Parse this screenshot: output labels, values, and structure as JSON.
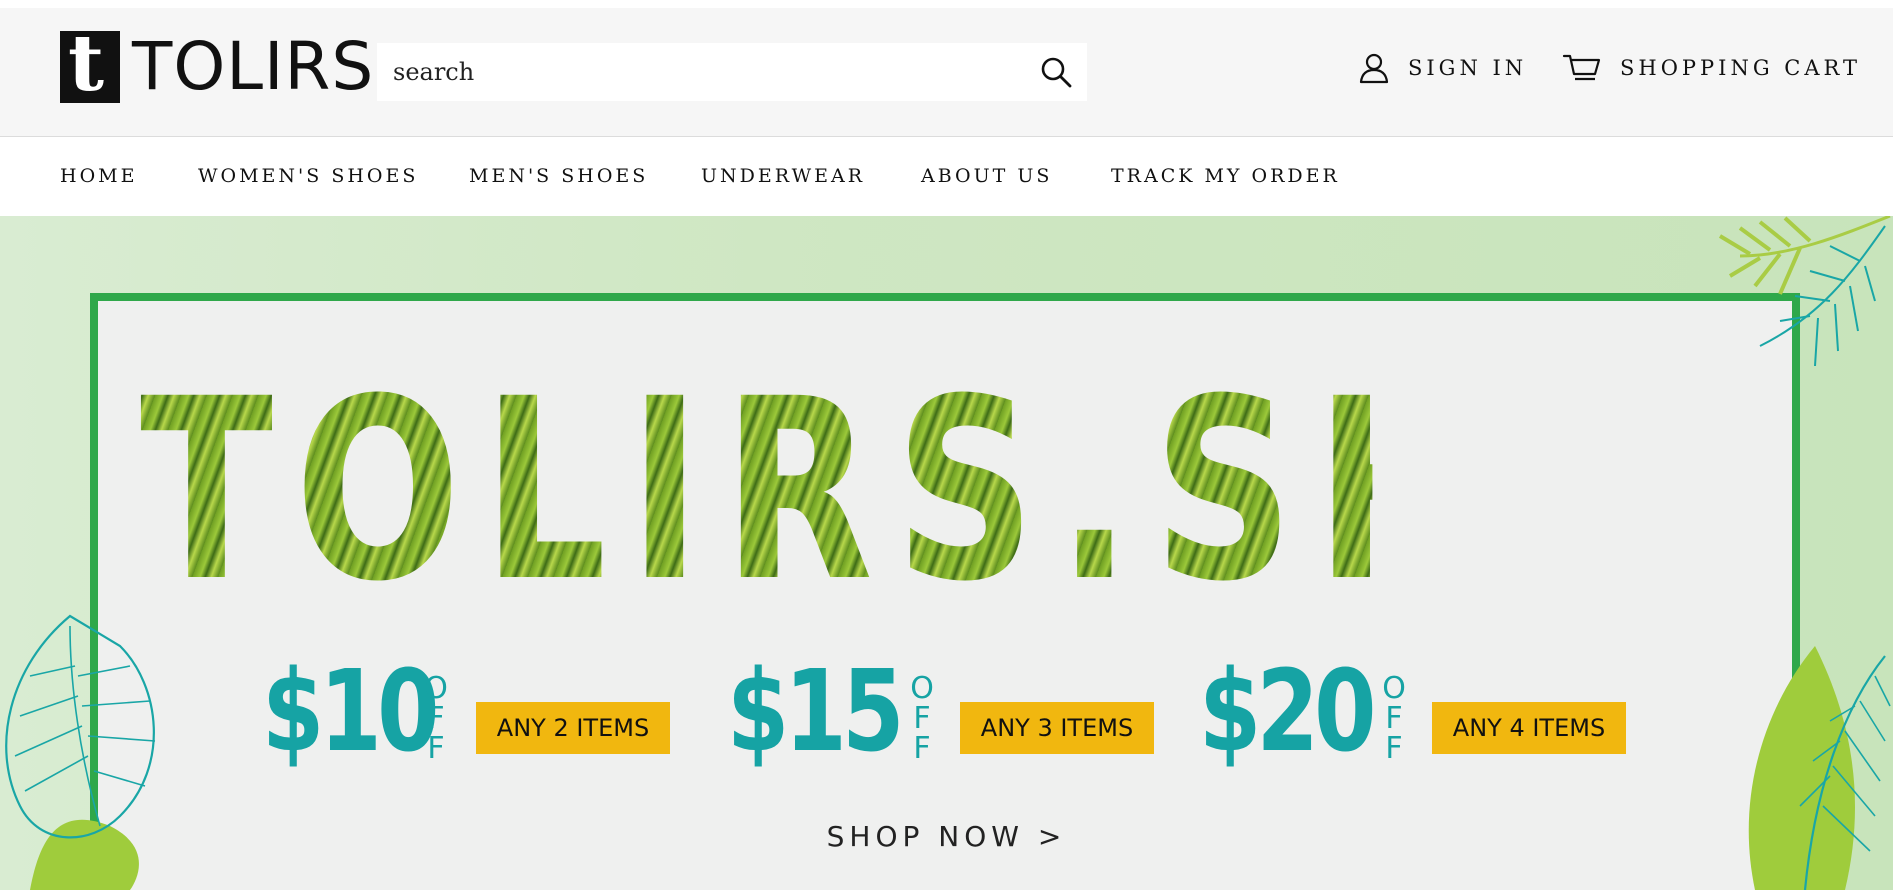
{
  "header": {
    "logo_mark": "t",
    "logo_text": "TOLIRS",
    "search_placeholder": "search",
    "sign_in": "SIGN IN",
    "cart": "SHOPPING CART",
    "search_icon": "search-icon",
    "account_icon": "user-icon",
    "cart_icon": "cart-icon"
  },
  "nav": {
    "items": [
      "HOME",
      "WOMEN'S SHOES",
      "MEN'S SHOES",
      "UNDERWEAR",
      "ABOUT US",
      "TRACK MY ORDER"
    ]
  },
  "banner": {
    "headline": "TOLIRS.SHOP",
    "offers": [
      {
        "price": "$10",
        "off": "OFF",
        "condition": "ANY 2 ITEMS"
      },
      {
        "price": "$15",
        "off": "OFF",
        "condition": "ANY 3 ITEMS"
      },
      {
        "price": "$20",
        "off": "OFF",
        "condition": "ANY 4 ITEMS"
      }
    ],
    "cta": "SHOP NOW >"
  },
  "colors": {
    "frame_green": "#2fa84a",
    "price_teal": "#16a3a4",
    "tag_yellow": "#f1b70f",
    "header_bg": "#f6f6f6"
  }
}
